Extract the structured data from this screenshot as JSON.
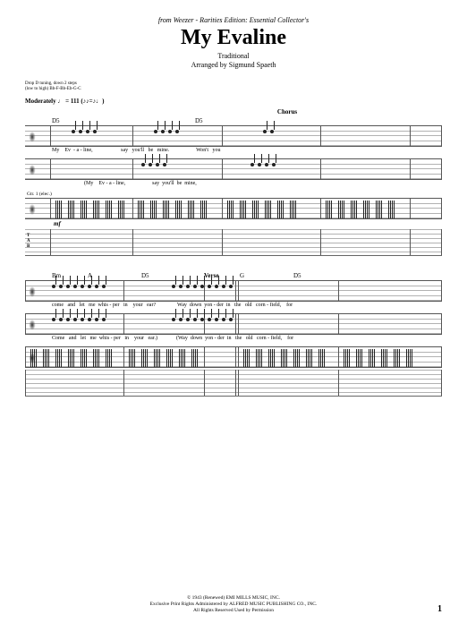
{
  "header": {
    "source": "from Weezer - Rarities Edition: Essential Collector's",
    "title": "My Evaline",
    "composer": "Traditional",
    "arranger": "Arranged by Sigmund Spaeth"
  },
  "tuning": {
    "line1": "Drop D tuning, down 2 steps",
    "line2": "(low to high) Bb-F-Bb-Eb-G-C"
  },
  "tempo": "Moderately ♩ = 111 (♪♪=♪♩)",
  "system1": {
    "section": "Chorus",
    "chords": [
      "D5",
      "",
      "D5",
      "",
      ""
    ],
    "vocal1_lyrics": "My    Ev  - a - line,                     say   you'll   be   mine.                    Won't   you",
    "vocal2_lyrics": "                        (My    Ev - a - line,                    say  you'll  be  mine,",
    "part_label": "Gtr. 1 (elec.)",
    "dynamic": "mf"
  },
  "system2": {
    "section": "Verse",
    "chords": [
      "Bm",
      "A",
      "D5",
      "",
      "G",
      "D5"
    ],
    "vocal1_lyrics": "come   and   let   me  whis - per   in    your   ear?                Way  down  yon - der  in   the   old   corn - field,    for",
    "vocal2_lyrics": "Come   and   let   me  whis - per   in    your   ear.)              (Way  down  yon - der  in   the   old   corn - field,    for"
  },
  "footer": {
    "copyright": "© 1943 (Renewed) EMI MILLS MUSIC, INC.",
    "rights": "Exclusive Print Rights Administered by ALFRED MUSIC PUBLISHING CO., INC.",
    "reserved": "All Rights Reserved   Used by Permission"
  },
  "page_number": "1"
}
